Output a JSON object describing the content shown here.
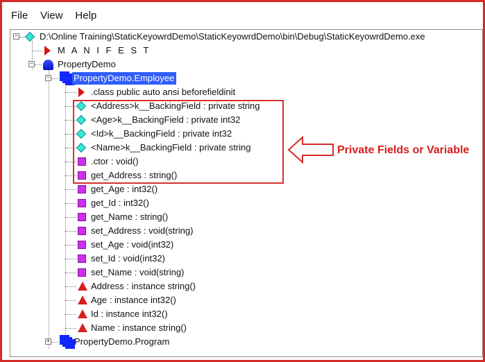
{
  "menu": {
    "items": [
      {
        "label": "File"
      },
      {
        "label": "View"
      },
      {
        "label": "Help"
      }
    ]
  },
  "tree": {
    "root": {
      "label": "D:\\Online Training\\StaticKeyowrdDemo\\StaticKeyowrdDemo\\bin\\Debug\\StaticKeyowrdDemo.exe",
      "icon": "assembly-diamond-icon",
      "expanded": true
    },
    "nodes": [
      {
        "label": "M A N I F E S T",
        "icon": "manifest-icon"
      },
      {
        "label": "PropertyDemo",
        "icon": "namespace-icon",
        "expanded": true
      },
      {
        "label": "PropertyDemo.Employee",
        "icon": "class-icon",
        "selected": true,
        "expanded": true
      },
      {
        "label": ".class public auto ansi beforefieldinit",
        "icon": "class-info-icon"
      },
      {
        "label": "<Address>k__BackingField : private string",
        "icon": "field-icon"
      },
      {
        "label": "<Age>k__BackingField : private int32",
        "icon": "field-icon"
      },
      {
        "label": "<Id>k__BackingField : private int32",
        "icon": "field-icon"
      },
      {
        "label": "<Name>k__BackingField : private string",
        "icon": "field-icon"
      },
      {
        "label": ".ctor : void()",
        "icon": "method-icon"
      },
      {
        "label": "get_Address : string()",
        "icon": "method-icon"
      },
      {
        "label": "get_Age : int32()",
        "icon": "method-icon"
      },
      {
        "label": "get_Id : int32()",
        "icon": "method-icon"
      },
      {
        "label": "get_Name : string()",
        "icon": "method-icon"
      },
      {
        "label": "set_Address : void(string)",
        "icon": "method-icon"
      },
      {
        "label": "set_Age : void(int32)",
        "icon": "method-icon"
      },
      {
        "label": "set_Id : void(int32)",
        "icon": "method-icon"
      },
      {
        "label": "set_Name : void(string)",
        "icon": "method-icon"
      },
      {
        "label": "Address : instance string()",
        "icon": "property-icon"
      },
      {
        "label": "Age : instance int32()",
        "icon": "property-icon"
      },
      {
        "label": "Id : instance int32()",
        "icon": "property-icon"
      },
      {
        "label": "Name : instance string()",
        "icon": "property-icon"
      },
      {
        "label": "PropertyDemo.Program",
        "icon": "class-icon",
        "expanded": false
      }
    ]
  },
  "annotation": {
    "text": "Private Fields or Variable",
    "color": "#d71c1c"
  },
  "colors": {
    "accent_border": "#d42a2a",
    "selection": "#315efa",
    "field": "#39e6d7",
    "method": "#cf2ef2",
    "property": "#d62020",
    "type": "#1127ff"
  }
}
